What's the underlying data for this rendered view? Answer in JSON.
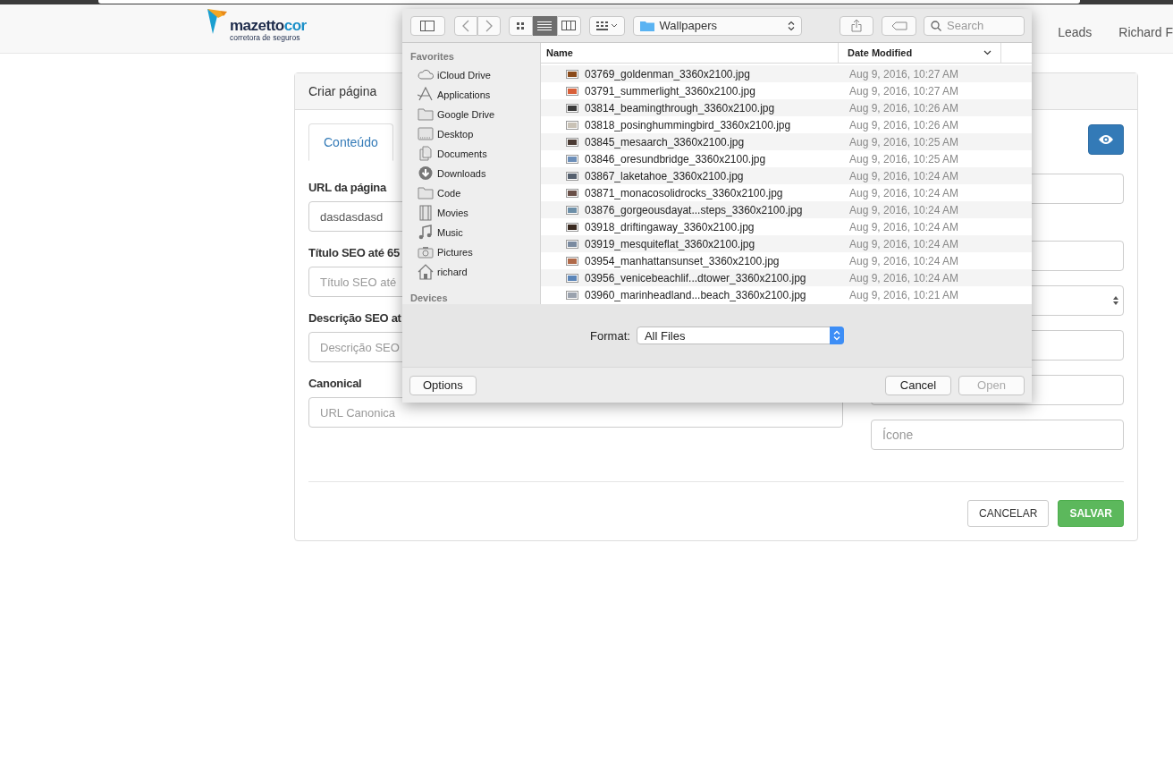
{
  "navbar": {
    "logo": {
      "name_main": "mazetto",
      "name_accent": "cor",
      "tagline": "corretora de seguros"
    },
    "links": [
      "Leads",
      "Richard F"
    ]
  },
  "panel": {
    "title": "Criar página",
    "tabs": [
      {
        "label": "Conteúdo",
        "selected": true
      }
    ],
    "left_fields": [
      {
        "label": "URL da página",
        "value": "dasdasdasd"
      },
      {
        "label": "Título SEO até 65",
        "placeholder": "Título SEO até"
      },
      {
        "label": "Descrição SEO at",
        "placeholder": "Descrição SEO"
      },
      {
        "label": "Canonical",
        "placeholder": "URL Canonica"
      }
    ],
    "right_fields": [
      {
        "kind": "text"
      },
      {
        "kind": "text"
      },
      {
        "kind": "select"
      },
      {
        "kind": "text"
      },
      {
        "kind": "text"
      },
      {
        "kind": "text",
        "placeholder": "Ícone"
      }
    ],
    "actions": [
      {
        "label": "CANCELAR",
        "kind": "default"
      },
      {
        "label": "SALVAR",
        "kind": "success"
      }
    ]
  },
  "dialog": {
    "view_modes": [
      {
        "kind": "icons",
        "selected": false
      },
      {
        "kind": "list",
        "selected": true
      },
      {
        "kind": "columns",
        "selected": false
      }
    ],
    "location": "Wallpapers",
    "search": {
      "placeholder": "Search"
    },
    "sidebar": [
      {
        "title": "Favorites",
        "items": [
          {
            "label": "iCloud Drive",
            "kind": "cloud"
          },
          {
            "label": "Applications",
            "kind": "apps"
          },
          {
            "label": "Google Drive",
            "kind": "folder"
          },
          {
            "label": "Desktop",
            "kind": "desktop"
          },
          {
            "label": "Documents",
            "kind": "documents"
          },
          {
            "label": "Downloads",
            "kind": "downloads"
          },
          {
            "label": "Code",
            "kind": "folder"
          },
          {
            "label": "Movies",
            "kind": "movies"
          },
          {
            "label": "Music",
            "kind": "music"
          },
          {
            "label": "Pictures",
            "kind": "pictures"
          },
          {
            "label": "richard",
            "kind": "home"
          }
        ]
      },
      {
        "title": "Devices"
      }
    ],
    "columns": [
      "Name",
      "Date Modified"
    ],
    "files": [
      {
        "name": "03769_goldenman_3360x2100.jpg",
        "date": "Aug 9, 2016, 10:27 AM"
      },
      {
        "name": "03791_summerlight_3360x2100.jpg",
        "date": "Aug 9, 2016, 10:27 AM"
      },
      {
        "name": "03814_beamingthrough_3360x2100.jpg",
        "date": "Aug 9, 2016, 10:26 AM"
      },
      {
        "name": "03818_posinghummingbird_3360x2100.jpg",
        "date": "Aug 9, 2016, 10:26 AM"
      },
      {
        "name": "03845_mesaarch_3360x2100.jpg",
        "date": "Aug 9, 2016, 10:25 AM"
      },
      {
        "name": "03846_oresundbridge_3360x2100.jpg",
        "date": "Aug 9, 2016, 10:25 AM"
      },
      {
        "name": "03867_laketahoe_3360x2100.jpg",
        "date": "Aug 9, 2016, 10:24 AM"
      },
      {
        "name": "03871_monacosolidrocks_3360x2100.jpg",
        "date": "Aug 9, 2016, 10:24 AM"
      },
      {
        "name": "03876_gorgeousdayat...steps_3360x2100.jpg",
        "date": "Aug 9, 2016, 10:24 AM"
      },
      {
        "name": "03918_driftingaway_3360x2100.jpg",
        "date": "Aug 9, 2016, 10:24 AM"
      },
      {
        "name": "03919_mesquiteflat_3360x2100.jpg",
        "date": "Aug 9, 2016, 10:24 AM"
      },
      {
        "name": "03954_manhattansunset_3360x2100.jpg",
        "date": "Aug 9, 2016, 10:24 AM"
      },
      {
        "name": "03956_venicebeachlif...dtower_3360x2100.jpg",
        "date": "Aug 9, 2016, 10:24 AM"
      },
      {
        "name": "03960_marinheadland...beach_3360x2100.jpg",
        "date": "Aug 9, 2016, 10:21 AM"
      }
    ],
    "format": {
      "label": "Format:",
      "value": "All Files"
    },
    "buttons": [
      {
        "label": "Options",
        "kind": "left",
        "disabled": false
      },
      {
        "label": "Cancel",
        "kind": "right",
        "disabled": false
      },
      {
        "label": "Open",
        "kind": "right",
        "disabled": true
      }
    ]
  }
}
